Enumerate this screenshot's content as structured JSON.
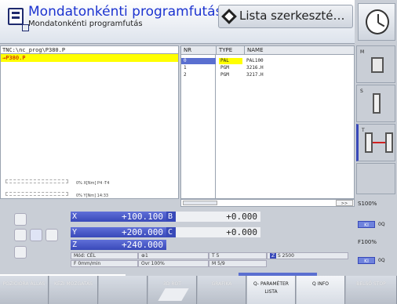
{
  "header": {
    "title": "Mondatonkénti programfutás",
    "subtitle": "Mondatonkénti programfutás",
    "list_tab": "Lista szerkeszté…"
  },
  "file_panel": {
    "path": "TNC:\\nc_prog\\P380.P",
    "selected_file": "→P380.P",
    "bar1_text": "0% X[Nm] P4 -T4",
    "bar2_text": "0% Y[Nm] 14:33"
  },
  "table": {
    "columns": [
      "NR",
      "TYPE",
      "NAME"
    ],
    "rows": [
      {
        "nr": "0",
        "type": "PAL",
        "name": "PAL100"
      },
      {
        "nr": "1",
        "type": "PGM",
        "name": "3216.H"
      },
      {
        "nr": "2",
        "type": "PGM",
        "name": "3217.H"
      }
    ],
    "scroll_next": ">>"
  },
  "axes": {
    "x_label": "X",
    "x_value": "+100.100",
    "b_label": "B",
    "b_value": "+0.000",
    "y_label": "Y",
    "y_value": "+200.000",
    "c_label": "C",
    "c_value": "+0.000",
    "z_label": "Z",
    "z_value": "+240.000"
  },
  "info": {
    "mode": "Mód: CÉL",
    "tool_icon_text": "1",
    "tool": "T 5",
    "spindle_tag": "Z",
    "spindle": "S 2500",
    "feed": "F 0mm/min",
    "override": "Ovr 100%",
    "misc": "M 5/9"
  },
  "right_panel": {
    "m_label": "M",
    "s_label": "S",
    "t_label": "T",
    "s_ratio": "S100%",
    "f_ratio": "F100%",
    "ki_1": "KI",
    "ki_2": "KI",
    "ki_1_suffix": "0Q",
    "ki_2_suffix": "0Q"
  },
  "softkeys": {
    "sk1": "POZÍCIÓRA ÁLLÁS",
    "sk2": "KÉZI MOZGATÁS",
    "sk3": "",
    "sk4": "3D ROT",
    "sk5": "GRAFIKA",
    "sk6": "Q- PARAMÉTER LISTA",
    "sk7": "Q INFO",
    "sk8": "BELSŐ STOP"
  },
  "colors": {
    "title_blue": "#1c33d0",
    "axis_blue": "#3849b9",
    "highlight_yellow": "#ffff00"
  }
}
